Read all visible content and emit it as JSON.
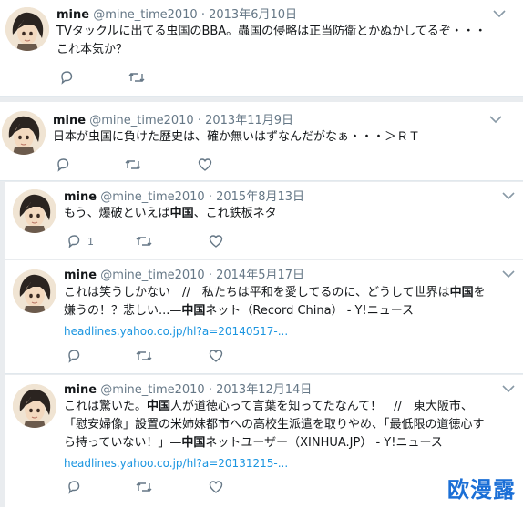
{
  "tweets": [
    {
      "name": "mine",
      "handle": "@mine_time2010",
      "dot": "·",
      "date": "2013年6月10日",
      "lines": [
        "TVタックルに出てる虫国のBBA。蟲国の侵略は正当防衛とかぬかしてるぞ・・・",
        "これ本気か？"
      ],
      "like_count": ""
    },
    {
      "name": "mine",
      "handle": "@mine_time2010",
      "dot": "·",
      "date": "2013年11月9日",
      "lines": [
        "日本が虫国に負けた歴史は、確か無いはずなんだがなぁ・・・＞ＲＴ"
      ],
      "like_count": ""
    },
    {
      "name": "mine",
      "handle": "@mine_time2010",
      "dot": "·",
      "date": "2015年8月13日",
      "line_parts": [
        "もう、爆破といえば",
        "中国",
        "、これ鉄板ネタ"
      ],
      "reply_count": "1"
    },
    {
      "name": "mine",
      "handle": "@mine_time2010",
      "dot": "·",
      "date": "2014年5月17日",
      "line1_parts": [
        "これは笑うしかない　//　私たちは平和を愛してるのに、どうして世界は",
        "中国",
        "を"
      ],
      "line2_parts": [
        "嫌うの！？悲しい...—",
        "中国",
        "ネット（Record China） - Y!ニュース"
      ],
      "link": "headlines.yahoo.co.jp/hl?a=20140517-..."
    },
    {
      "name": "mine",
      "handle": "@mine_time2010",
      "dot": "·",
      "date": "2013年12月14日",
      "line1_parts": [
        "これは驚いた。",
        "中国",
        "人が道徳心って言葉を知ってたなんて！　//　東大阪市、"
      ],
      "line2": "「慰安婦像」設置の米姉妹都市への高校生派遣を取りやめ、「最低限の道徳心す",
      "line3_parts": [
        "ら持っていない！」—",
        "中国",
        "ネットユーザー（XINHUA.JP） - Y!ニュース"
      ],
      "link": "headlines.yahoo.co.jp/hl?a=20131215-..."
    }
  ],
  "watermark": "欧漫露",
  "colors": {
    "link": "#1b95e0",
    "muted": "#657786",
    "watermark": "#1b6fd6"
  },
  "icons": [
    "reply-icon",
    "retweet-icon",
    "like-icon",
    "chevron-down-icon"
  ]
}
